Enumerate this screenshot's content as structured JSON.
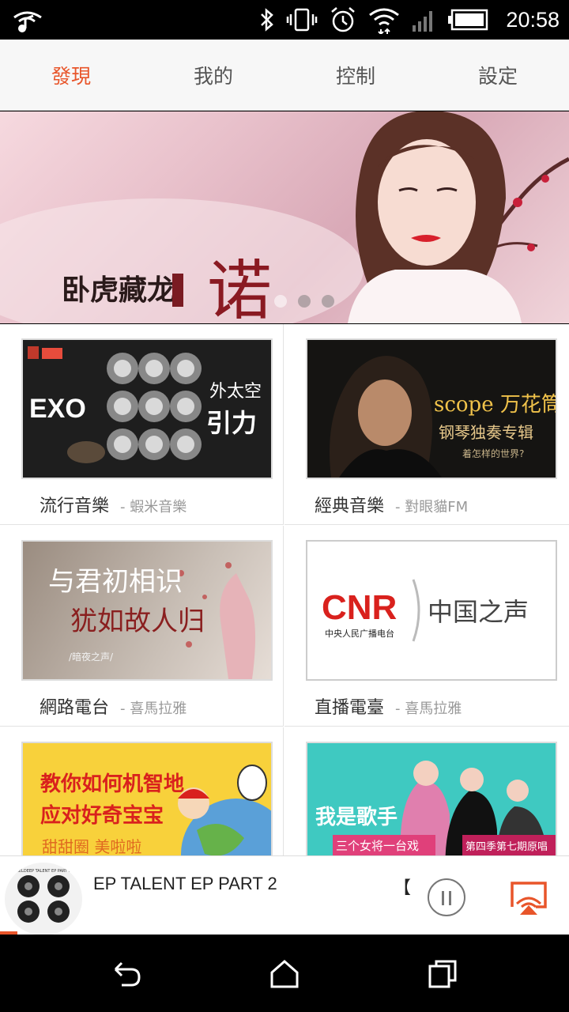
{
  "status_bar": {
    "time": "20:58",
    "icons": [
      "music-wifi-icon",
      "bluetooth-icon",
      "vibrate-icon",
      "alarm-icon",
      "wifi-icon",
      "signal-icon",
      "battery-icon"
    ]
  },
  "tabs": [
    {
      "label": "發現",
      "active": true
    },
    {
      "label": "我的",
      "active": false
    },
    {
      "label": "控制",
      "active": false
    },
    {
      "label": "設定",
      "active": false
    }
  ],
  "banner": {
    "text": "卧虎藏龙",
    "text2": "诺",
    "pages": 3,
    "active_page": 2
  },
  "categories": [
    {
      "title": "流行音樂",
      "source": "- 蝦米音樂",
      "thumb_text_1": "EXO",
      "thumb_text_2": "外太空",
      "thumb_text_3": "引力"
    },
    {
      "title": "經典音樂",
      "source": "- 對眼貓FM",
      "thumb_text_1": "scope 万花筒",
      "thumb_text_2": "钢琴独奏专辑",
      "thumb_text_3": "着怎样的世界?"
    },
    {
      "title": "網路電台",
      "source": "- 喜馬拉雅",
      "thumb_text_1": "与君初相识",
      "thumb_text_2": "犹如故人归",
      "thumb_text_3": "/暗夜之声/"
    },
    {
      "title": "直播電臺",
      "source": "- 喜馬拉雅",
      "thumb_text_1": "CNR",
      "thumb_text_2": "中央人民广播电台",
      "thumb_text_3": "中国之声"
    },
    {
      "title": "",
      "source": "",
      "thumb_text_1": "教你如何机智地",
      "thumb_text_2": "应对好奇宝宝",
      "thumb_text_3": "甜甜圈 美啦啦"
    },
    {
      "title": "",
      "source": "",
      "thumb_text_1": "我是歌手",
      "thumb_text_2": "三个女将一台戏",
      "thumb_text_3": "第四季第七期原唱"
    }
  ],
  "player": {
    "song_title": "EP TALENT EP PART 2",
    "bracket": "【",
    "cover_text": "HELDEEP TALENT EP PART 2",
    "progress": 0.03
  },
  "colors": {
    "accent": "#e8552a",
    "cnr_red": "#d9211d",
    "teal_bg": "#3fc9c1",
    "yellow_bg": "#f8d13b"
  }
}
